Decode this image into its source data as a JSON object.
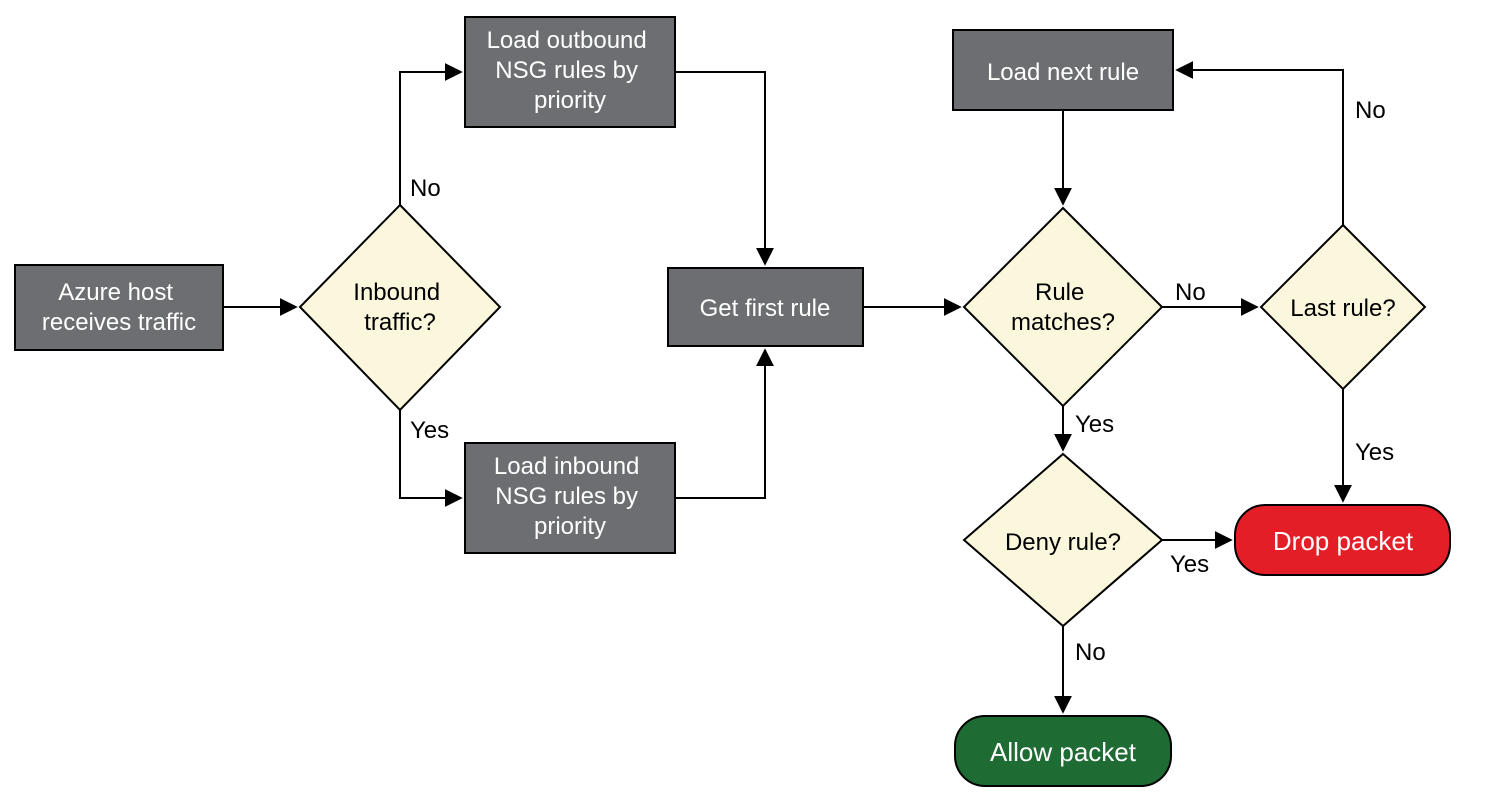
{
  "nodes": {
    "start": {
      "line1": "Azure host",
      "line2": "receives traffic"
    },
    "inbound": {
      "line1": "Inbound",
      "line2": "traffic?"
    },
    "loadOutbound": {
      "line1": "Load outbound",
      "line2": "NSG rules by",
      "line3": "priority"
    },
    "loadInbound": {
      "line1": "Load inbound",
      "line2": "NSG rules by",
      "line3": "priority"
    },
    "getFirst": {
      "line1": "Get first rule"
    },
    "loadNext": {
      "line1": "Load next rule"
    },
    "ruleMatches": {
      "line1": "Rule",
      "line2": "matches?"
    },
    "lastRule": {
      "line1": "Last rule?"
    },
    "denyRule": {
      "line1": "Deny rule?"
    },
    "drop": {
      "line1": "Drop packet"
    },
    "allow": {
      "line1": "Allow packet"
    }
  },
  "labels": {
    "yes": "Yes",
    "no": "No"
  },
  "colors": {
    "process": "#6d6e71",
    "decision": "#fbf7dc",
    "drop": "#e41e26",
    "allow": "#1e6b33",
    "stroke": "#000000"
  }
}
